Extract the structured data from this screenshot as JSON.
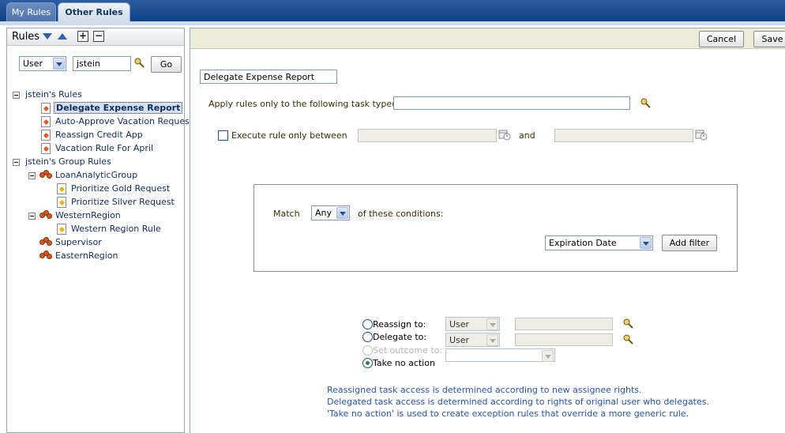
{
  "tabs": [
    {
      "label": "My Rules"
    },
    {
      "label": "Other Rules"
    }
  ],
  "left_panel": {
    "title": "Rules",
    "user_type": "User",
    "user_name": "jstein",
    "go_label": "Go",
    "tree": {
      "my_rules_label": "jstein's Rules",
      "my_rules": [
        {
          "label": "Delegate Expense Report",
          "selected": true
        },
        {
          "label": "Auto-Approve Vacation Request"
        },
        {
          "label": "Reassign Credit App"
        },
        {
          "label": "Vacation Rule For April"
        }
      ],
      "group_rules_label": "jstein's Group Rules",
      "groups": [
        {
          "label": "LoanAnalyticGroup",
          "rules": [
            "Prioritize Gold Request",
            "Prioritize Silver Request"
          ]
        },
        {
          "label": "WesternRegion",
          "rules": [
            "Western Region Rule"
          ]
        },
        {
          "label": "Supervisor"
        },
        {
          "label": "EasternRegion"
        }
      ]
    }
  },
  "toolbar": {
    "cancel_label": "Cancel",
    "save_label": "Save"
  },
  "form": {
    "rule_name": "Delegate Expense Report",
    "task_types_label": "Apply rules only to the following task type(s):",
    "task_types_value": "",
    "execute_between_label": "Execute rule only between",
    "and_label": "and",
    "match_label": "Match",
    "match_value": "Any",
    "conditions_label": "of these conditions:",
    "filter_field": "Expiration Date",
    "add_filter_label": "Add filter",
    "actions": {
      "reassign_label": "Reassign to:",
      "reassign_type": "User",
      "delegate_label": "Delegate to:",
      "delegate_type": "User",
      "outcome_label": "Set outcome to:",
      "no_action_label": "Take no action",
      "selected": "Take no action"
    },
    "info": [
      "Reassigned task access is determined according to new assignee rights.",
      "Delegated task access is determined according to rights of original user who delegates.",
      "'Take no action' is used to create exception rules that override a more generic rule."
    ]
  },
  "colors": {
    "tabbar": "#0a3d86",
    "toolbar": "#ecedd8",
    "info_text": "#2655b0",
    "tree_text": "#112d5c"
  }
}
